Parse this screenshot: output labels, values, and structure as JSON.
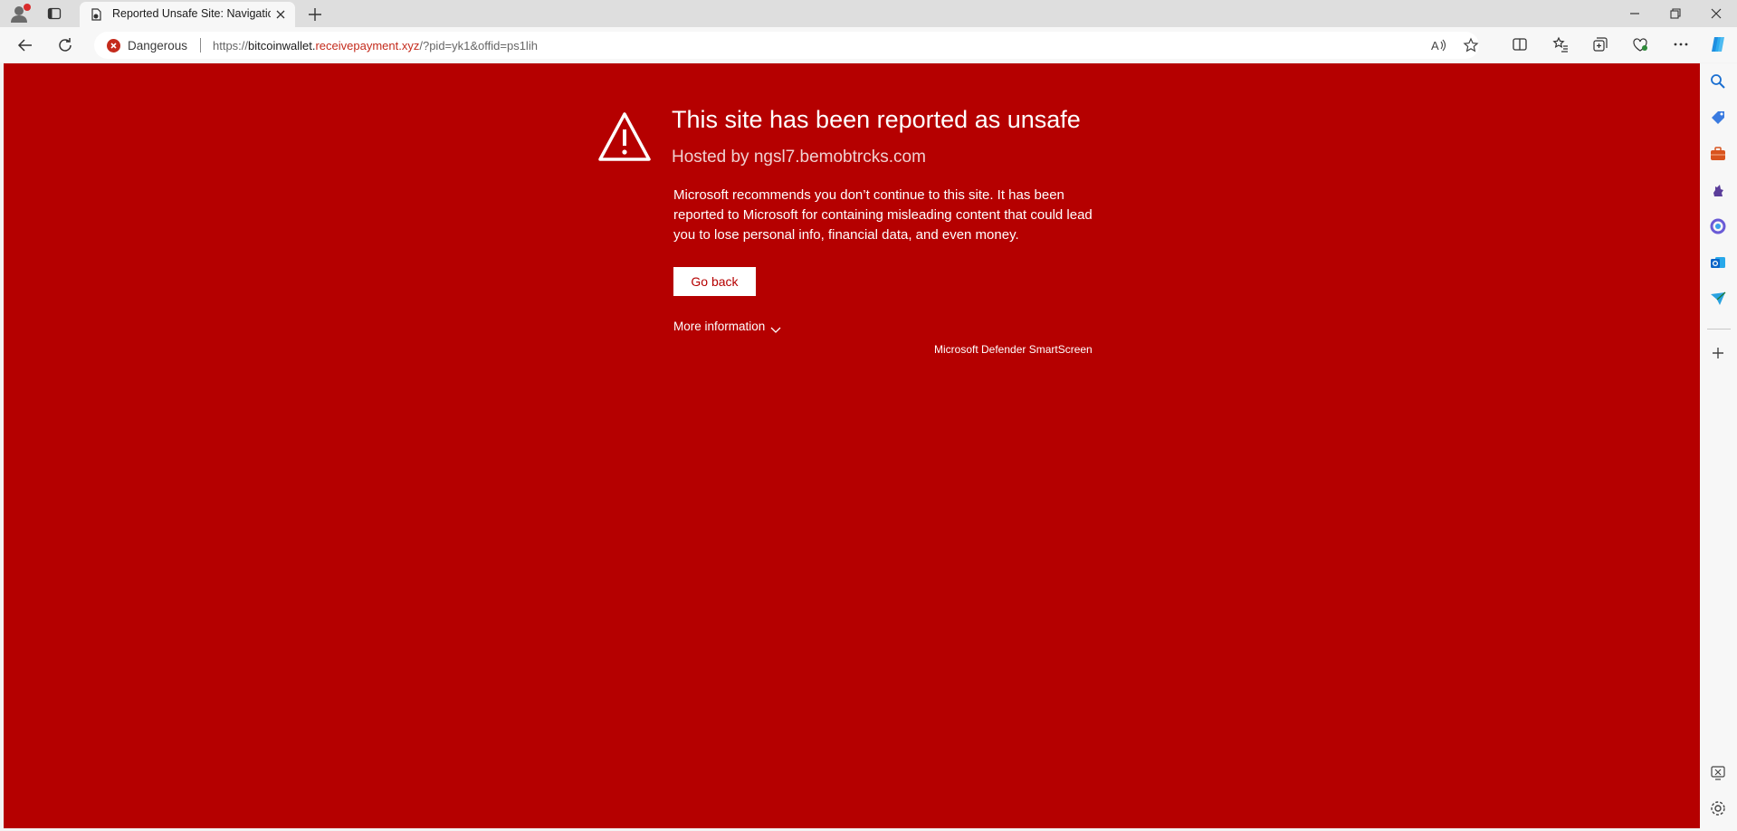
{
  "browser": {
    "tab": {
      "title": "Reported Unsafe Site: Navigation"
    },
    "address_bar": {
      "security_label": "Dangerous",
      "url_prefix": "https://",
      "url_host": "bitcoinwallet.",
      "url_domain": "receivepayment.xyz",
      "url_path": "/?pid=yk1&offid=ps1lih"
    }
  },
  "page": {
    "headline": "This site has been reported as unsafe",
    "hosted_by": "Hosted by ngsl7.bemobtrcks.com",
    "description": "Microsoft recommends you don’t continue to this site. It has been reported to Microsoft for containing misleading content that could lead you to lose personal info, financial data, and even money.",
    "go_back_label": "Go back",
    "more_info_label": "More information",
    "footer_brand": "Microsoft Defender SmartScreen"
  },
  "colors": {
    "page_background": "#b50000",
    "danger": "#c42b1c",
    "button_text": "#b50000"
  },
  "icons": {
    "sidebar": [
      "search-icon",
      "shopping-tag-icon",
      "tools-briefcase-icon",
      "games-icon",
      "microsoft365-icon",
      "outlook-icon",
      "send-icon",
      "add-icon",
      "screenshot-icon",
      "settings-icon"
    ]
  }
}
